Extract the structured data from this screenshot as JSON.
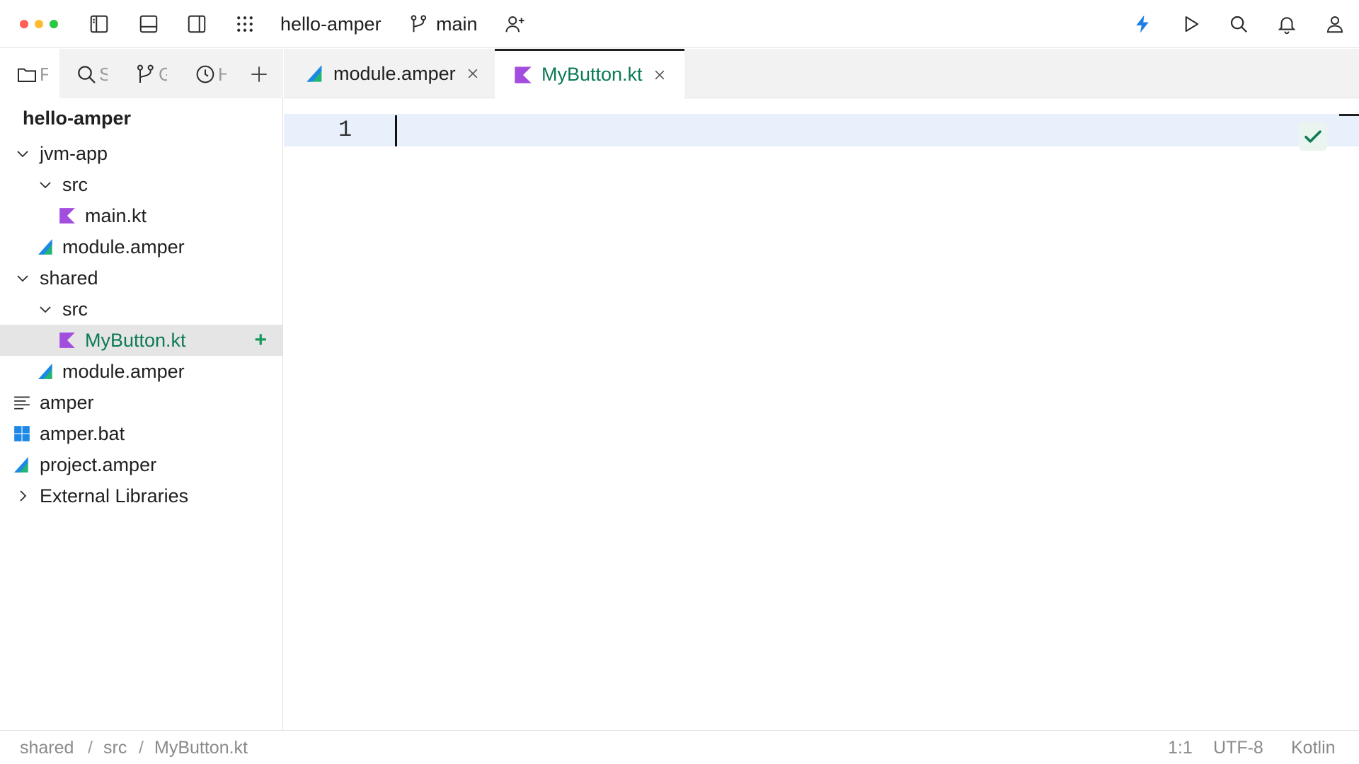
{
  "titlebar": {
    "project": "hello-amper",
    "branch": "main"
  },
  "sidebar": {
    "tabs": [
      {
        "icon": "folder-icon",
        "label": "F"
      },
      {
        "icon": "search-icon",
        "label": "S"
      },
      {
        "icon": "git-branch-icon",
        "label": "G"
      },
      {
        "icon": "clock-icon",
        "label": "H"
      }
    ],
    "root": "hello-amper",
    "tree": [
      {
        "label": "jvm-app",
        "icon": "chevron-down-icon",
        "type": "folder"
      },
      {
        "label": "src",
        "icon": "chevron-down-icon",
        "type": "folder"
      },
      {
        "label": "main.kt",
        "icon": "kotlin-file-icon",
        "type": "file"
      },
      {
        "label": "module.amper",
        "icon": "amper-file-icon",
        "type": "file"
      },
      {
        "label": "shared",
        "icon": "chevron-down-icon",
        "type": "folder"
      },
      {
        "label": "src",
        "icon": "chevron-down-icon",
        "type": "folder"
      },
      {
        "label": "MyButton.kt",
        "icon": "kotlin-file-icon",
        "type": "file",
        "selected": true,
        "badge": "+"
      },
      {
        "label": "module.amper",
        "icon": "amper-file-icon",
        "type": "file"
      },
      {
        "label": "amper",
        "icon": "text-file-icon",
        "type": "file"
      },
      {
        "label": "amper.bat",
        "icon": "windows-file-icon",
        "type": "file"
      },
      {
        "label": "project.amper",
        "icon": "amper-file-icon",
        "type": "file"
      },
      {
        "label": "External Libraries",
        "icon": "chevron-right-icon",
        "type": "folder"
      }
    ]
  },
  "editor": {
    "tabs": [
      {
        "label": "module.amper",
        "icon": "amper-file-icon",
        "active": false
      },
      {
        "label": "MyButton.kt",
        "icon": "kotlin-file-icon",
        "active": true
      }
    ],
    "line_number": "1"
  },
  "statusbar": {
    "breadcrumb": [
      "shared",
      "src",
      "MyButton.kt"
    ],
    "separator": "/",
    "position": "1:1",
    "encoding": "UTF-8",
    "language": "Kotlin"
  },
  "colors": {
    "accent_green": "#0b7a55",
    "selection_row": "#e5e5e5",
    "current_line": "#e8f1fb",
    "kotlin_purple": "#a24dde",
    "action_blue": "#1e7ee8"
  }
}
